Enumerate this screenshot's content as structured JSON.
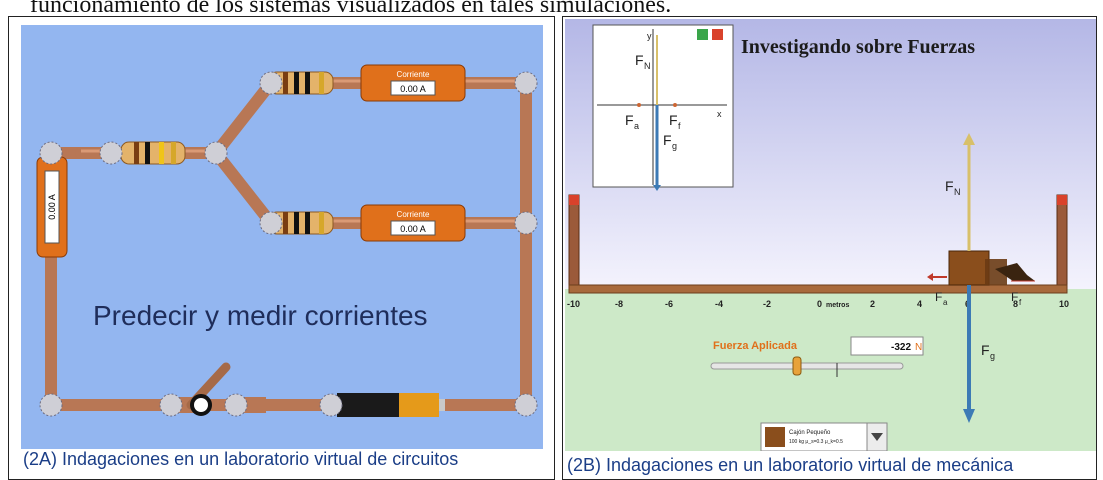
{
  "page": {
    "top_caption": "funcionamiento de los sistemas visualizados en tales simulaciones."
  },
  "fig_a": {
    "caption": "(2A) Indagaciones en un laboratorio virtual de circuitos",
    "sim_text": "Predecir y medir corrientes",
    "ammeters": [
      {
        "title": "Corriente",
        "value": "0.00 A"
      },
      {
        "title": "Corriente",
        "value": "0.00 A"
      },
      {
        "title": "Corriente",
        "value": "0.00 A"
      }
    ],
    "colors": {
      "background": "#93b6f0",
      "wire": "#c98560",
      "meter": "#e0701b"
    }
  },
  "fig_b": {
    "caption": "(2B) Indagaciones en un laboratorio virtual de mecánica",
    "title": "Investigando sobre Fuerzas",
    "fbd_labels": {
      "fn": "F",
      "fn_sub": "N",
      "fa": "F",
      "fa_sub": "a",
      "ff": "F",
      "ff_sub": "f",
      "fg": "F",
      "fg_sub": "g",
      "x": "x",
      "y": "y"
    },
    "ruler_ticks": [
      "-10",
      "-8",
      "-6",
      "-4",
      "-2",
      "0",
      "2",
      "4",
      "6",
      "8",
      "10"
    ],
    "ruler_unit": "metros",
    "applied_force": {
      "label": "Fuerza Aplicada",
      "value": "-322",
      "unit": "N"
    },
    "object_selector": {
      "name": "Cajón Pequeño",
      "detail": "100 kg μ_s=0.3 μ_k=0.5"
    },
    "colors": {
      "sky_top": "#b4b7e6",
      "sky_bottom": "#f4f3fd",
      "ground": "#cde9c8",
      "fn_arrow": "#d8c06a",
      "fg_arrow": "#3c7ab5"
    }
  }
}
